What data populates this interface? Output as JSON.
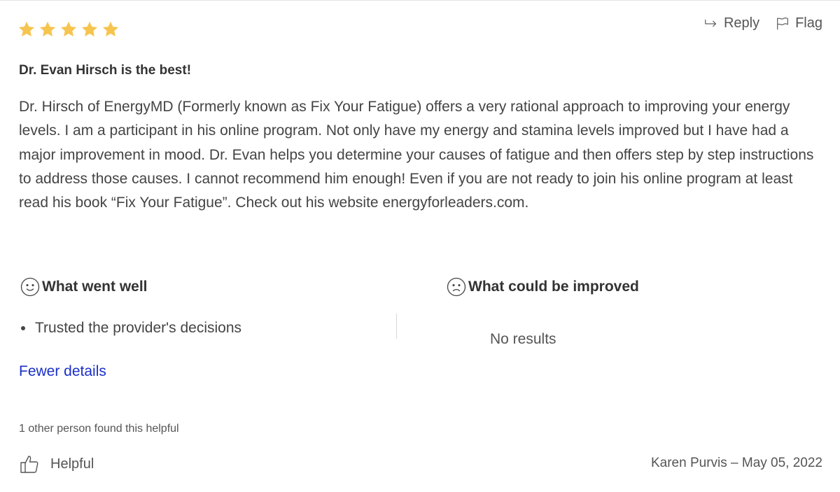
{
  "review": {
    "rating": 5,
    "rating_max": 5,
    "star_color": "#f6c44f",
    "title": "Dr. Evan Hirsch is the best!",
    "body": "Dr. Hirsch of EnergyMD (Formerly known as Fix Your Fatigue) offers a very rational approach to improving your energy levels. I am a participant in his online program. Not only have my energy and stamina levels improved but I have had a major improvement in mood. Dr. Evan helps you determine your causes of fatigue and then offers step by step instructions to address those causes. I cannot recommend him enough! Even if you are not ready to join his online program at least read his book “Fix Your Fatigue”. Check out his website energyforleaders.com.",
    "author_date": "Karen Purvis – May 05, 2022"
  },
  "actions": {
    "reply_label": "Reply",
    "reply_icon": "reply-arrow-icon",
    "flag_label": "Flag",
    "flag_icon": "flag-icon"
  },
  "feedback": {
    "well_heading": "What went well",
    "well_icon": "smile-face-icon",
    "well_items": [
      "Trusted the provider's decisions"
    ],
    "improve_heading": "What could be improved",
    "improve_icon": "frown-face-icon",
    "improve_empty": "No results",
    "toggle_label": "Fewer details",
    "link_color": "#1a2fc7"
  },
  "helpful": {
    "count_text": "1 other person found this helpful",
    "button_label": "Helpful",
    "button_icon": "thumbs-up-icon"
  }
}
